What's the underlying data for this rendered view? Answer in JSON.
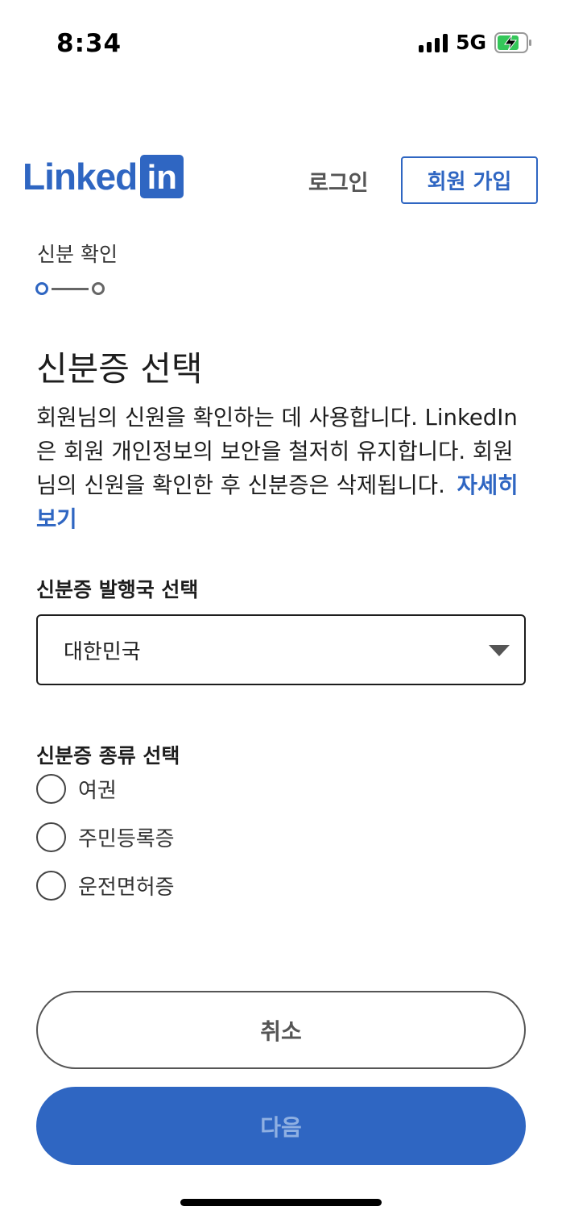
{
  "status_bar": {
    "time": "8:34",
    "network": "5G",
    "battery_icon": "battery-charging-icon",
    "signal_icon": "signal-icon"
  },
  "header": {
    "logo_text": "Linked",
    "logo_box": "in",
    "login_label": "로그인",
    "join_label": "회원 가입"
  },
  "step": {
    "label": "신분 확인",
    "current": 1,
    "total": 2
  },
  "main": {
    "title": "신분증 선택",
    "description": "회원님의 신원을 확인하는 데 사용합니다. LinkedIn은 회원 개인정보의 보안을 철저히 유지합니다. 회원님의 신원을 확인한 후 신분증은 삭제됩니다.",
    "learn_more": "자세히 보기"
  },
  "country": {
    "label": "신분증 발행국 선택",
    "selected": "대한민국"
  },
  "id_type": {
    "label": "신분증 종류 선택",
    "options": [
      {
        "label": "여권"
      },
      {
        "label": "주민등록증"
      },
      {
        "label": "운전면허증"
      }
    ]
  },
  "buttons": {
    "cancel": "취소",
    "next": "다음"
  },
  "colors": {
    "accent": "#2f66c2",
    "next_text_disabled": "#8fb0e2"
  }
}
